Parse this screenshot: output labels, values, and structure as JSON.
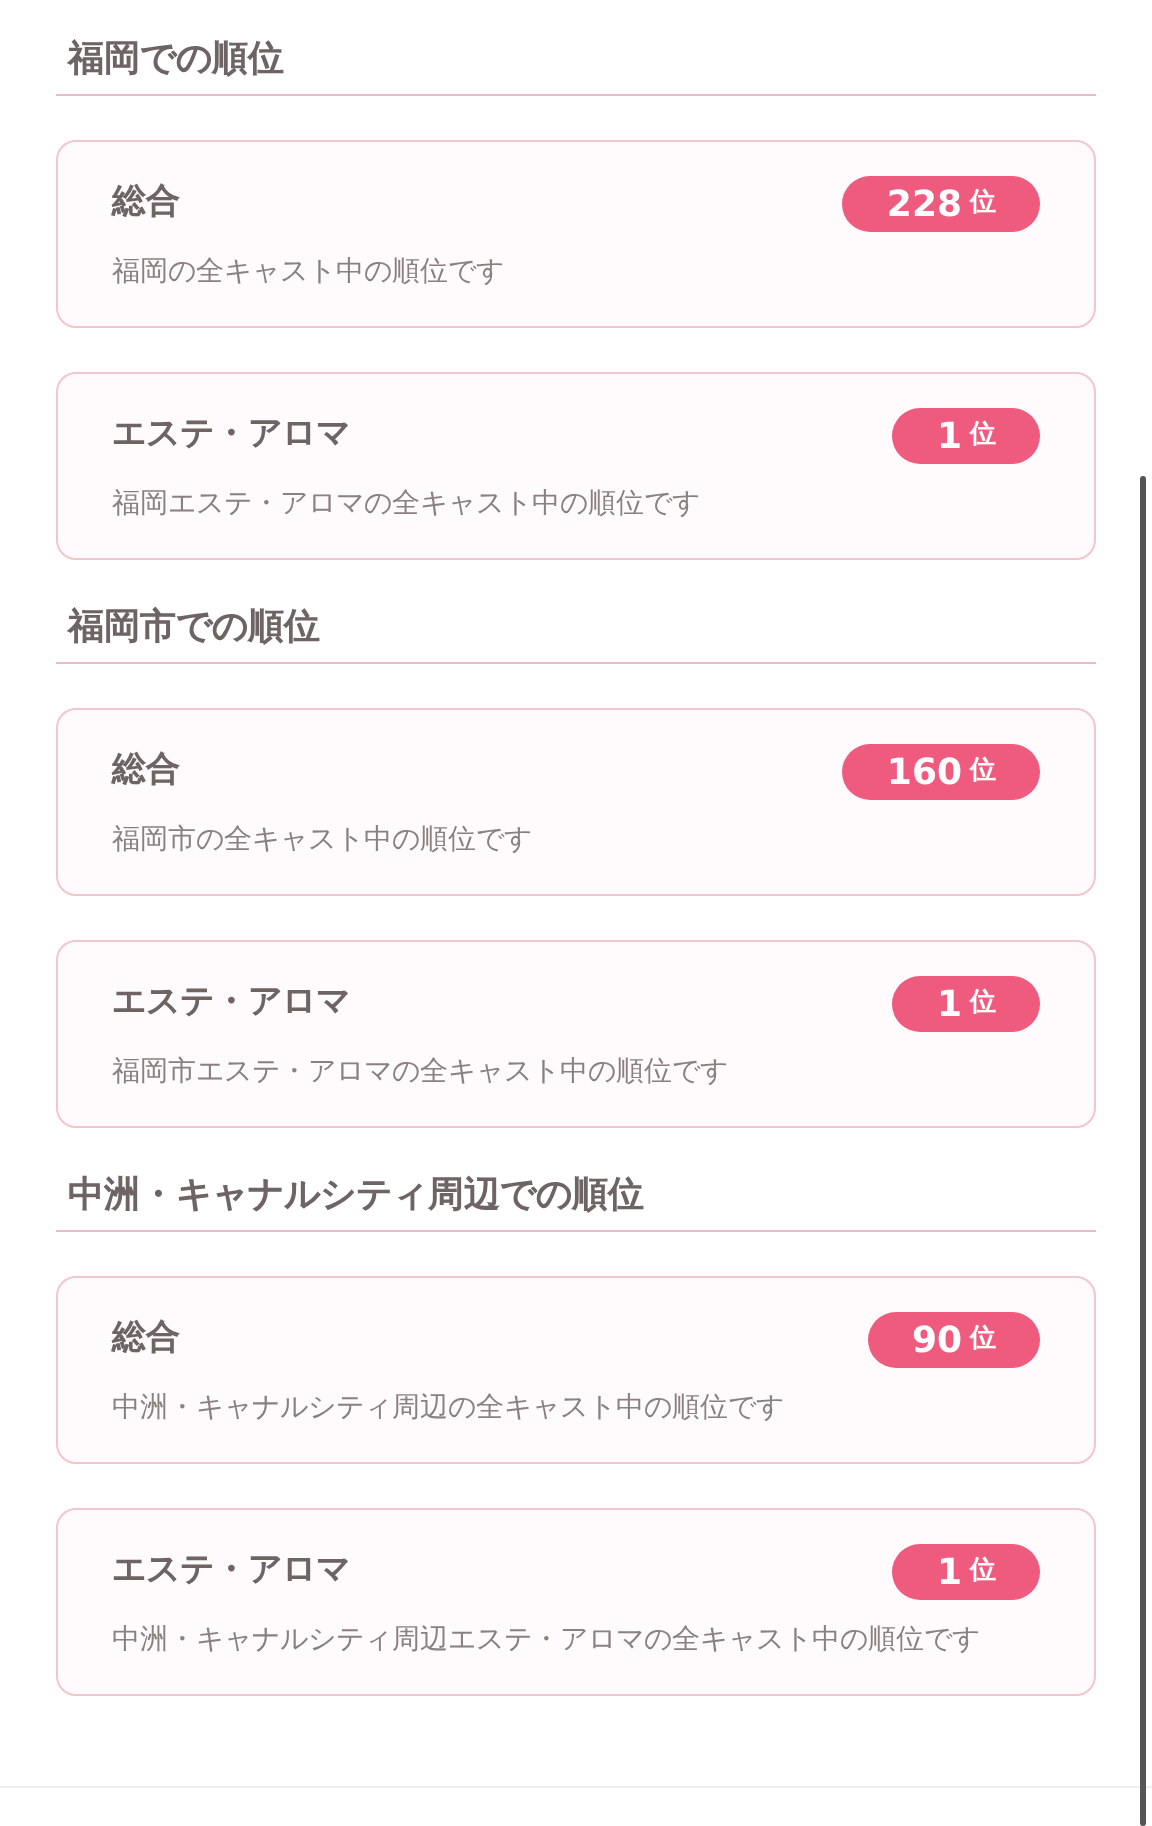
{
  "sections": [
    {
      "heading": "福岡での順位",
      "rankings": [
        {
          "category": "総合",
          "description": "福岡の全キャスト中の順位です",
          "rank": "228",
          "unit": "位"
        },
        {
          "category": "エステ・アロマ",
          "description": "福岡エステ・アロマの全キャスト中の順位です",
          "rank": "1",
          "unit": "位"
        }
      ]
    },
    {
      "heading": "福岡市での順位",
      "rankings": [
        {
          "category": "総合",
          "description": "福岡市の全キャスト中の順位です",
          "rank": "160",
          "unit": "位"
        },
        {
          "category": "エステ・アロマ",
          "description": "福岡市エステ・アロマの全キャスト中の順位です",
          "rank": "1",
          "unit": "位"
        }
      ]
    },
    {
      "heading": "中洲・キャナルシティ周辺での順位",
      "rankings": [
        {
          "category": "総合",
          "description": "中洲・キャナルシティ周辺の全キャスト中の順位です",
          "rank": "90",
          "unit": "位"
        },
        {
          "category": "エステ・アロマ",
          "description": "中洲・キャナルシティ周辺エステ・アロマの全キャスト中の順位です",
          "rank": "1",
          "unit": "位"
        }
      ]
    }
  ]
}
